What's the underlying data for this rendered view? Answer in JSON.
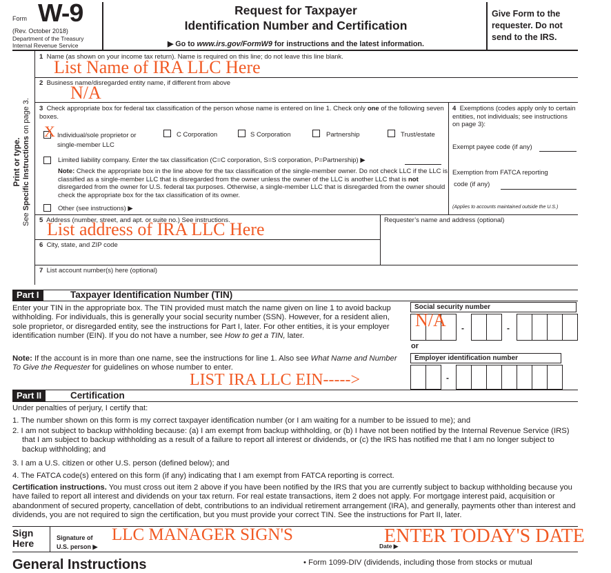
{
  "header": {
    "form_label": "Form",
    "form_number": "W-9",
    "revision": "(Rev. October 2018)",
    "department": "Department of the Treasury",
    "service": "Internal Revenue Service",
    "title_line1": "Request for Taxpayer",
    "title_line2": "Identification Number and Certification",
    "goto_prefix": "▶ Go to ",
    "goto_url": "www.irs.gov/FormW9",
    "goto_suffix": " for instructions and the latest information.",
    "give_form": "Give Form to the requester. Do not send to the IRS."
  },
  "sidebar": {
    "print_or_type": "Print or type.",
    "see_prefix": "See ",
    "see_bold": "Specific Instructions",
    "see_suffix": " on page 3."
  },
  "lines": {
    "line1": {
      "num": "1",
      "label": "Name (as shown on your income tax return). Name is required on this line; do not leave this line blank.",
      "value": "List Name of IRA LLC Here"
    },
    "line2": {
      "num": "2",
      "label": "Business name/disregarded entity name, if different from above",
      "value": "N/A"
    },
    "line3": {
      "num": "3",
      "label_a": "Check appropriate box for federal tax classification of the person whose name is entered on line 1. Check only ",
      "label_bold": "one",
      "label_b": " of the following seven boxes.",
      "options": [
        {
          "label": "Individual/sole proprietor or",
          "label2": "single-member LLC",
          "checked": true,
          "mark": "X"
        },
        {
          "label": "C Corporation",
          "checked": false
        },
        {
          "label": "S Corporation",
          "checked": false
        },
        {
          "label": "Partnership",
          "checked": false
        },
        {
          "label": "Trust/estate",
          "checked": false
        }
      ],
      "llc_label": "Limited liability company. Enter the tax classification (C=C corporation, S=S corporation, P=Partnership) ▶",
      "llc_value": "",
      "note_bold": "Note:",
      "note_a": " Check the appropriate box in the line above for the tax classification of the single-member owner.  Do not check LLC if the LLC is classified as a single-member LLC that is disregarded from the owner unless the owner of the LLC is another LLC that is ",
      "note_bold2": "not",
      "note_b": " disregarded from the owner for U.S. federal tax purposes. Otherwise, a single-member LLC that is disregarded from the owner should check the appropriate box for the tax classification of its owner.",
      "other_label": "Other (see instructions) ▶"
    },
    "line4": {
      "num": "4",
      "label": "Exemptions (codes apply only to certain entities, not individuals; see instructions on page 3):",
      "exempt_payee": "Exempt payee code (if any)",
      "fatca": "Exemption from FATCA reporting code (if any)",
      "fatca_line1": "Exemption from FATCA reporting",
      "fatca_line2": "code (if any)",
      "applies": "(Applies to accounts maintained outside the U.S.)"
    },
    "line5": {
      "num": "5",
      "label": "Address (number, street, and apt. or suite no.) See instructions.",
      "value": "List address of IRA LLC Here"
    },
    "requester": {
      "label": "Requester’s name and address (optional)"
    },
    "line6": {
      "num": "6",
      "label": "City, state, and ZIP code",
      "value": ""
    },
    "line7": {
      "num": "7",
      "label": "List account number(s) here (optional)",
      "value": ""
    }
  },
  "part1": {
    "tag": "Part I",
    "title": "Taxpayer Identification Number (TIN)",
    "text_a": "Enter your TIN in the appropriate box. The TIN provided must match the name given on line 1 to avoid backup withholding. For individuals, this is generally your social security number (SSN). However, for a resident alien, sole proprietor, or disregarded entity, see the instructions for Part I, later. For other entities, it is your employer identification number (EIN). If you do not have a number, see ",
    "text_italic": "How to get a TIN,",
    "text_b": " later.",
    "note_bold": "Note:",
    "note_a": " If the account is in more than one name, see the instructions for line 1. Also see ",
    "note_italic": "What Name and Number To Give the Requester",
    "note_b": " for guidelines on whose number to enter.",
    "ssn_label": "Social security number",
    "ssn_value": "N/A",
    "or_label": "or",
    "ein_label": "Employer identification number",
    "ein_annotation": "LIST IRA LLC EIN----->",
    "dash": "-"
  },
  "part2": {
    "tag": "Part II",
    "title": "Certification",
    "intro": "Under penalties of perjury, I certify that:",
    "items": [
      "1. The number shown on this form is my correct taxpayer identification number (or I am waiting for a number to be issued to me); and",
      "2. I am not subject to backup withholding because: (a) I am exempt from backup withholding, or (b) I have not been notified by the Internal Revenue Service (IRS) that I am subject to backup withholding as a result of a failure to report all interest or dividends, or (c) the IRS has notified me that I am no longer subject to backup withholding; and",
      "3. I am a U.S. citizen or other U.S. person (defined below); and",
      "4. The FATCA code(s) entered on this form (if any) indicating that I am exempt from FATCA reporting is correct."
    ],
    "cert_bold": "Certification instructions.",
    "cert_text": " You must cross out item 2 above if you have been notified by the IRS that you are currently subject to backup withholding because you have failed to report all interest and dividends on your tax return. For real estate transactions, item 2 does not apply. For mortgage interest paid, acquisition or abandonment of secured property, cancellation of debt, contributions to an individual retirement arrangement (IRA), and generally, payments other than interest and dividends, you are not required to sign the certification, but you must provide your correct TIN. See the instructions for Part II, later."
  },
  "sign": {
    "sign_here1": "Sign",
    "sign_here2": "Here",
    "sig_label1": "Signature of",
    "sig_label2": "U.S. person ▶",
    "sig_value": "LLC MANAGER SIGN'S",
    "date_label": "Date ▶",
    "date_value": "ENTER TODAY'S DATE"
  },
  "footer": {
    "general_instructions": "General Instructions",
    "bullet": "• Form 1099-DIV (dividends, including those from stocks or mutual"
  },
  "colors": {
    "ink": "#231f20",
    "handwriting": "#f15a24"
  }
}
